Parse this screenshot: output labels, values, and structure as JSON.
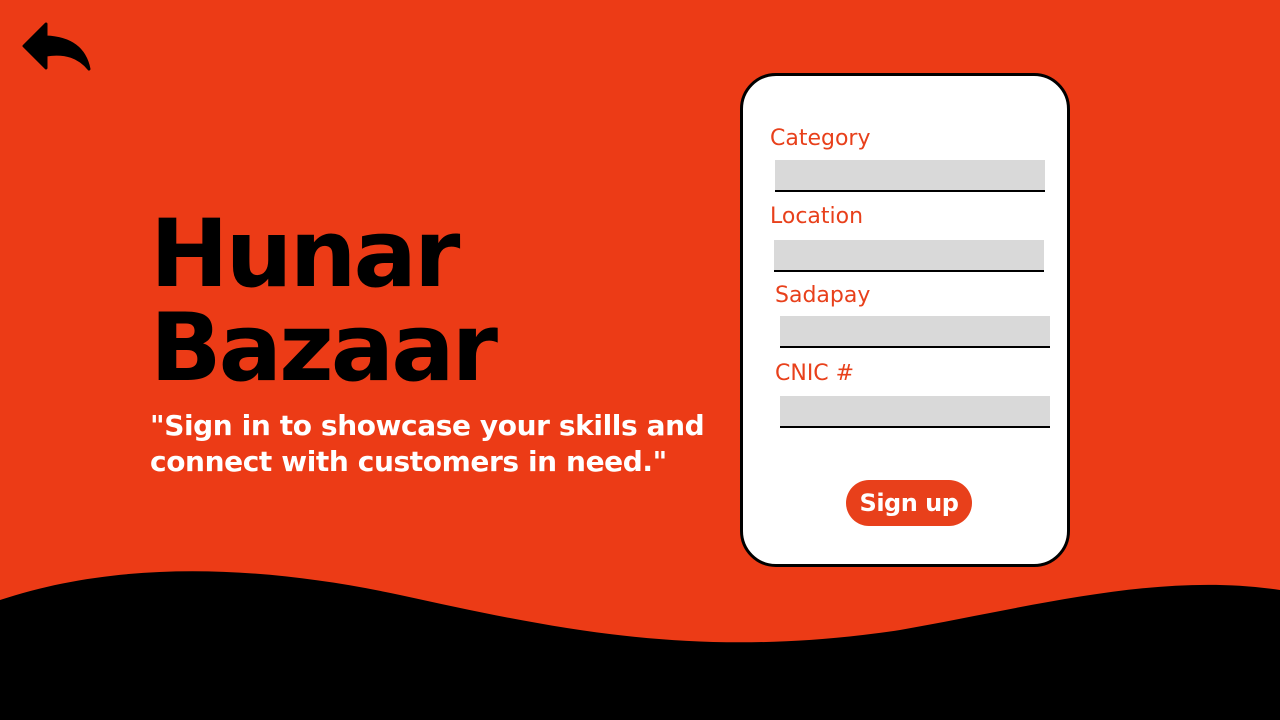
{
  "brand": {
    "line1": "Hunar",
    "line2": "Bazaar"
  },
  "tagline": "\"Sign in to showcase your skills and connect with customers in need.\"",
  "form": {
    "fields": [
      {
        "label": "Category",
        "value": ""
      },
      {
        "label": "Location",
        "value": ""
      },
      {
        "label": "Sadapay",
        "value": ""
      },
      {
        "label": "CNIC #",
        "value": ""
      }
    ],
    "submit_label": "Sign up"
  },
  "icons": {
    "back": "back-arrow-icon"
  },
  "colors": {
    "background": "#EC3B16",
    "accent": "#E8401B",
    "dark": "#000000",
    "input_fill": "#D9D9D9",
    "card": "#FFFFFF"
  }
}
